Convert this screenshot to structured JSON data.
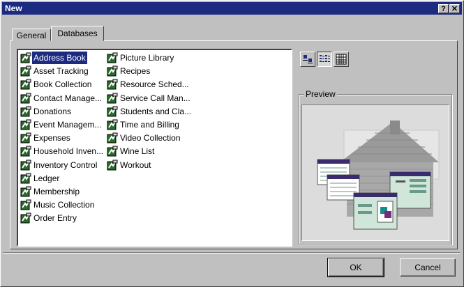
{
  "window": {
    "title": "New",
    "help_label": "?",
    "close_label": "✕"
  },
  "tabs": [
    {
      "label": "General"
    },
    {
      "label": "Databases",
      "active": true
    }
  ],
  "templates": {
    "column1": [
      {
        "label": "Address Book",
        "selected": true
      },
      {
        "label": "Asset Tracking"
      },
      {
        "label": "Book Collection"
      },
      {
        "label": "Contact Manage..."
      },
      {
        "label": "Donations"
      },
      {
        "label": "Event Managem..."
      },
      {
        "label": "Expenses"
      },
      {
        "label": "Household Inven..."
      },
      {
        "label": "Inventory Control"
      },
      {
        "label": "Ledger"
      },
      {
        "label": "Membership"
      },
      {
        "label": "Music Collection"
      },
      {
        "label": "Order Entry"
      }
    ],
    "column2": [
      {
        "label": "Picture Library"
      },
      {
        "label": "Recipes"
      },
      {
        "label": "Resource Sched..."
      },
      {
        "label": "Service Call Man..."
      },
      {
        "label": "Students and Cla..."
      },
      {
        "label": "Time and Billing"
      },
      {
        "label": "Video Collection"
      },
      {
        "label": "Wine List"
      },
      {
        "label": "Workout"
      }
    ],
    "item_icon": "database-wizard-icon"
  },
  "view_buttons": [
    {
      "name": "large-icons-view",
      "active": false
    },
    {
      "name": "list-view",
      "active": true
    },
    {
      "name": "details-view",
      "active": false
    }
  ],
  "preview": {
    "label": "Preview",
    "image": "database-house-illustration"
  },
  "buttons": {
    "ok": "OK",
    "cancel": "Cancel"
  },
  "colors": {
    "titlebar": "#1c2a80",
    "face": "#c0c0c0",
    "selection": "#1c2a80"
  }
}
